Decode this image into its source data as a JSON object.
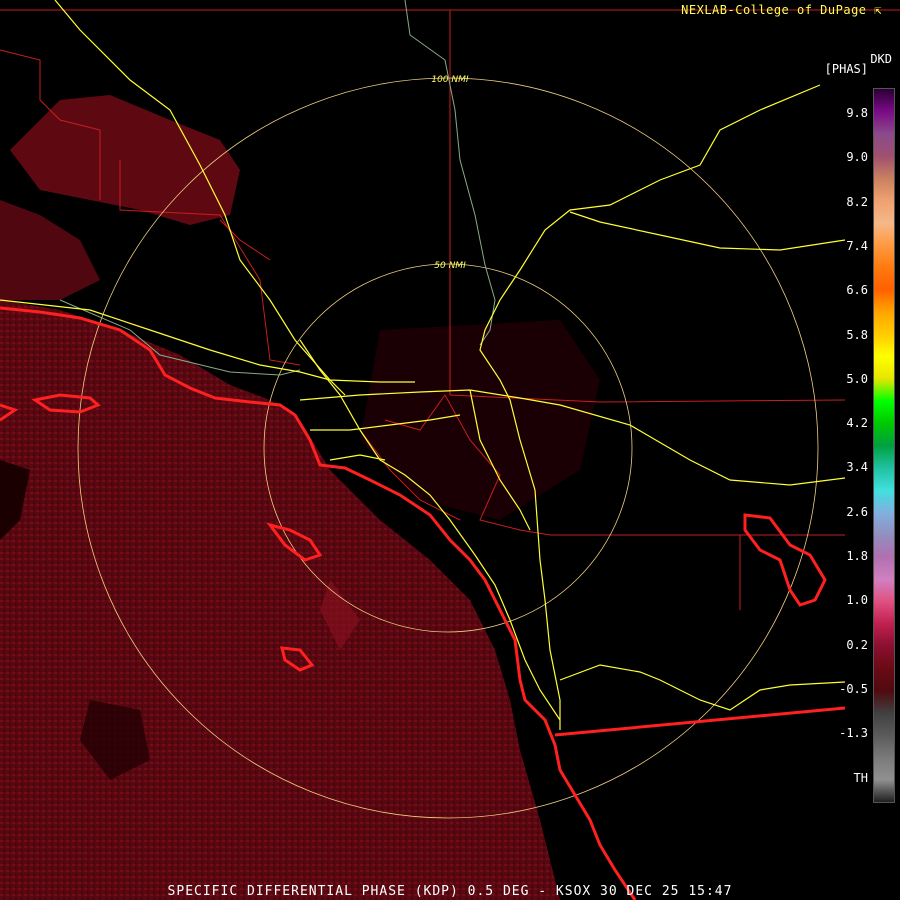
{
  "header": {
    "credit": "NEXLAB-College of DuPage",
    "credit_icon": "cursor-arrow-icon",
    "product_code": "DKD",
    "units": "[PHAS]"
  },
  "rings": {
    "inner_label": "50 NMI",
    "outer_label": "100 NMI"
  },
  "legend": {
    "labels": [
      "9.8",
      "9.0",
      "8.2",
      "7.4",
      "6.6",
      "5.8",
      "5.0",
      "4.2",
      "3.4",
      "2.6",
      "1.8",
      "1.0",
      "0.2",
      "-0.5",
      "-1.3",
      "TH"
    ],
    "colors": [
      "#2a0033",
      "#7a0a85",
      "#8a4a8a",
      "#a05070",
      "#c88060",
      "#f0a070",
      "#f5b888",
      "#ff9a40",
      "#ff7a10",
      "#ff6000",
      "#ffa500",
      "#ffcc00",
      "#ffff00",
      "#e6e600",
      "#00ff00",
      "#00c800",
      "#00a040",
      "#20c0a0",
      "#40e0e0",
      "#80b0e0",
      "#9090c0",
      "#b070b0",
      "#d080c0",
      "#e05080",
      "#c02050",
      "#8a1030",
      "#6a0a15",
      "#500a10",
      "#404040",
      "#5a5a5a",
      "#7a7a7a",
      "#909090",
      "#202020"
    ],
    "colors_meaning": "colorbar gradient top to bottom"
  },
  "footer": {
    "title": "SPECIFIC DIFFERENTIAL PHASE (KDP) 0.5 DEG - KSOX 30 DEC 25 15:47"
  },
  "colors": {
    "background": "#000000",
    "echo": "#6e0a14",
    "coast": "#ff2020",
    "roads": "#ffff33",
    "borders": "#c81e1e",
    "rings": "#f0d080",
    "rivers": "#88aa88"
  }
}
